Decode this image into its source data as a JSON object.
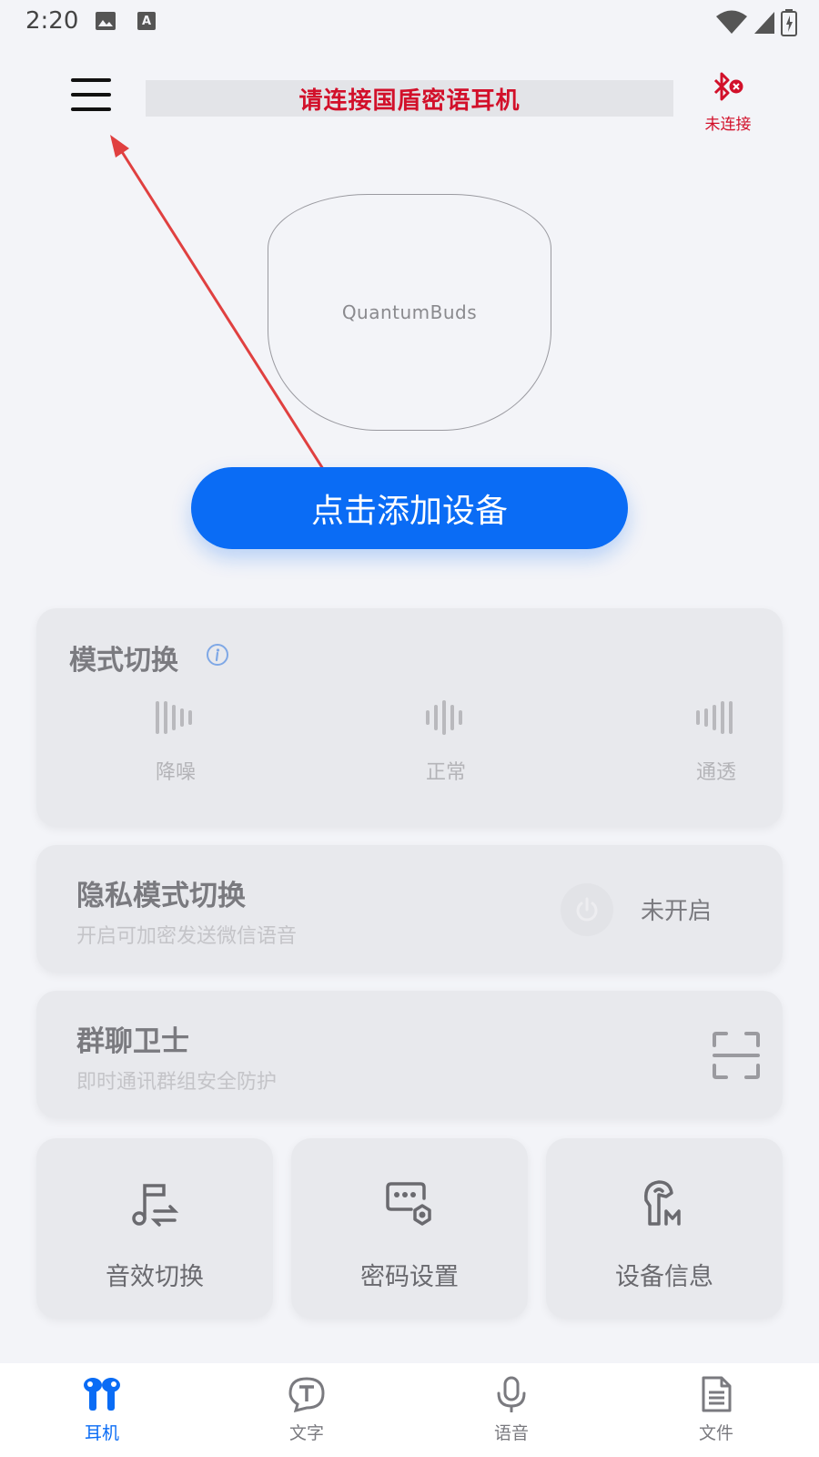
{
  "status_bar": {
    "time": "2:20",
    "icons": [
      "image-icon",
      "text-a-icon",
      "wifi-icon",
      "signal-icon",
      "battery-icon"
    ]
  },
  "header": {
    "menu_icon": "hamburger-menu-icon",
    "title": "请连接国盾密语耳机",
    "bluetooth_icon": "bluetooth-disconnected-icon",
    "bluetooth_status": "未连接"
  },
  "device": {
    "name": "QuantumBuds"
  },
  "add_device_button": "点击添加设备",
  "mode_switch": {
    "title": "模式切换",
    "info_icon": "info-icon",
    "options": [
      {
        "label": "降噪",
        "icon": "noise-cancel-wave-icon"
      },
      {
        "label": "正常",
        "icon": "normal-wave-icon"
      },
      {
        "label": "通透",
        "icon": "transparent-wave-icon"
      }
    ]
  },
  "privacy_mode": {
    "title": "隐私模式切换",
    "subtitle": "开启可加密发送微信语音",
    "state": "未开启",
    "icon": "power-icon"
  },
  "group_guard": {
    "title": "群聊卫士",
    "subtitle": "即时通讯群组安全防护",
    "icon": "scan-icon"
  },
  "tiles": [
    {
      "label": "音效切换",
      "icon": "music-switch-icon"
    },
    {
      "label": "密码设置",
      "icon": "password-settings-icon"
    },
    {
      "label": "设备信息",
      "icon": "earphone-info-icon"
    }
  ],
  "bottom_nav": [
    {
      "label": "耳机",
      "icon": "earbuds-icon",
      "active": true
    },
    {
      "label": "文字",
      "icon": "text-bubble-icon",
      "active": false
    },
    {
      "label": "语音",
      "icon": "microphone-icon",
      "active": false
    },
    {
      "label": "文件",
      "icon": "document-icon",
      "active": false
    }
  ],
  "colors": {
    "accent": "#0a6cf5",
    "alert_red": "#d2102a",
    "background": "#f3f4f8",
    "card": "#e8e9ed"
  }
}
